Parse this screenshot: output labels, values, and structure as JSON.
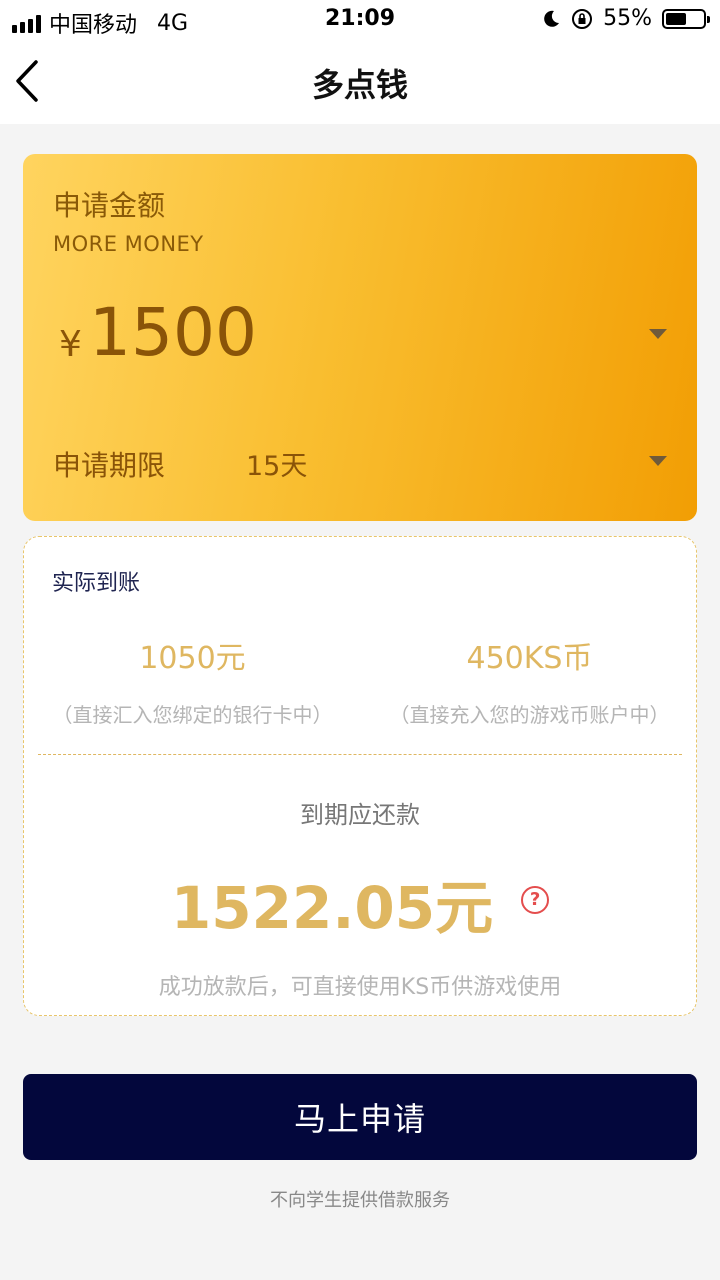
{
  "status_bar": {
    "carrier": "中国移动",
    "network": "4G",
    "time": "21:09",
    "battery": "55%",
    "battery_level": 0.55,
    "icons": [
      "signal-icon",
      "moon-icon",
      "rotation-lock-icon",
      "battery-icon"
    ]
  },
  "nav": {
    "title": "多点钱",
    "back_icon": "chevron-left-icon"
  },
  "amount_card": {
    "label": "申请金额",
    "sub_label": "MORE MONEY",
    "currency_symbol": "¥",
    "amount": "1500",
    "term_label": "申请期限",
    "term_value": "15天",
    "gradient_colors": [
      "#ffd45f",
      "#f29e04"
    ]
  },
  "details": {
    "title": "实际到账",
    "bank_amount": "1050元",
    "bank_note": "（直接汇入您绑定的银行卡中）",
    "coin_amount": "450KS币",
    "coin_note": "（直接充入您的游戏币账户中）",
    "repay_label": "到期应还款",
    "repay_amount": "1522.05元",
    "help_icon_text": "?",
    "footer_note": "成功放款后，可直接使用KS币供游戏使用"
  },
  "apply_button": {
    "label": "马上申请",
    "color": "#03073c"
  },
  "disclaimer": "不向学生提供借款服务",
  "colors": {
    "gold_text": "#dfb761",
    "brown_text": "#8a5408",
    "navy": "#03073c",
    "help_red": "#e44d4d"
  }
}
